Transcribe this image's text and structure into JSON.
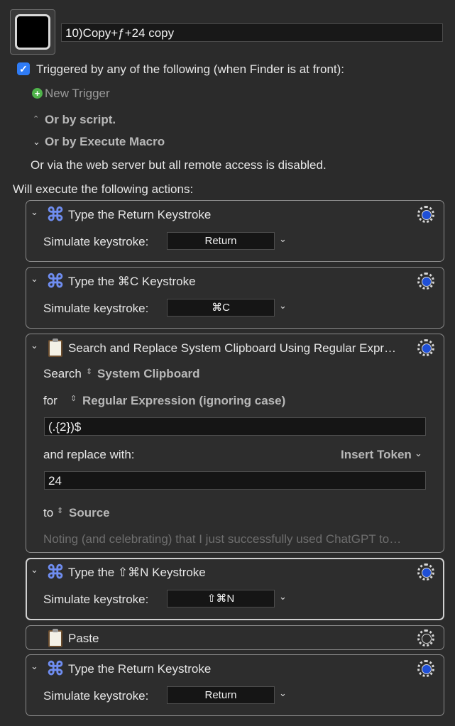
{
  "macro": {
    "name": "10)Copy+ƒ+24 copy"
  },
  "trigger": {
    "header": "Triggered by any of the following (when Finder is at front):",
    "checked": true,
    "new_trigger": "New Trigger",
    "or_by_script": "Or by script.",
    "or_by_execute_macro": "Or by Execute Macro",
    "web_server_note": "Or via the web server but all remote access is disabled."
  },
  "actions_header": "Will execute the following actions:",
  "actions": [
    {
      "title": "Type the Return Keystroke",
      "field_label": "Simulate keystroke:",
      "key": "Return"
    },
    {
      "title": "Type the ⌘C Keystroke",
      "field_label": "Simulate keystroke:",
      "key": "⌘C"
    },
    {
      "title": "Search and Replace System Clipboard Using Regular Expr…",
      "search_label": "Search",
      "search_source": "System Clipboard",
      "for_label": "for",
      "for_mode": "Regular Expression (ignoring case)",
      "pattern": "(.{2})$",
      "replace_label": "and replace with:",
      "insert_token": "Insert Token",
      "replacement": "24",
      "to_label": "to",
      "to_target": "Source",
      "note": "Noting (and celebrating) that I just successfully used ChatGPT to…"
    },
    {
      "title": "Type the ⇧⌘N Keystroke",
      "field_label": "Simulate keystroke:",
      "key": "⇧⌘N"
    },
    {
      "title": "Paste"
    },
    {
      "title": "Type the Return Keystroke",
      "field_label": "Simulate keystroke:",
      "key": "Return"
    }
  ],
  "icons": {
    "collapse": "chevron-down-icon",
    "keystroke": "command-key-icon",
    "clipboard": "clipboard-icon",
    "gear": "gear-icon",
    "add": "plus-circle-icon"
  },
  "colors": {
    "accent_blue": "#2f7cf6",
    "command_icon": "#6f8df0",
    "add_green": "#4fb34a"
  }
}
